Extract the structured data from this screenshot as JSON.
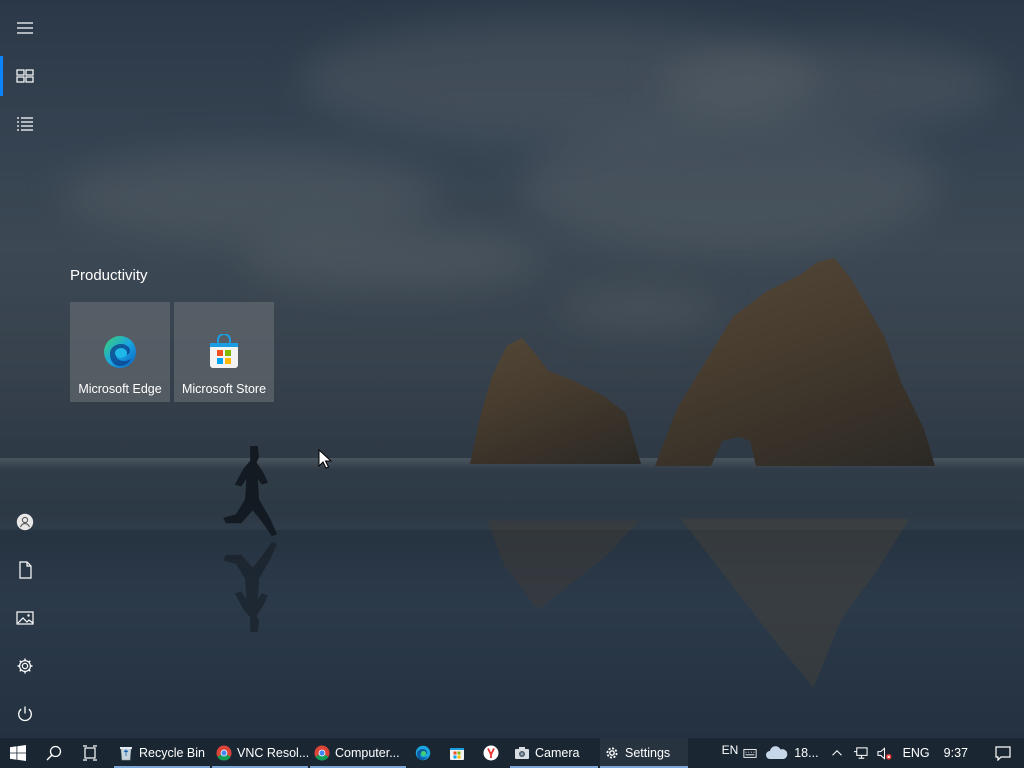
{
  "start_menu": {
    "rail": {
      "items": [
        {
          "name": "expand",
          "icon": "hamburger-icon"
        },
        {
          "name": "pinned-tiles",
          "icon": "tiles-icon",
          "active": true
        },
        {
          "name": "all-apps",
          "icon": "list-icon"
        },
        {
          "name": "user",
          "icon": "user-icon"
        },
        {
          "name": "documents",
          "icon": "document-icon"
        },
        {
          "name": "pictures",
          "icon": "picture-icon"
        },
        {
          "name": "settings",
          "icon": "gear-icon"
        },
        {
          "name": "power",
          "icon": "power-icon"
        }
      ]
    },
    "group": {
      "title": "Productivity",
      "tiles": [
        {
          "label": "Microsoft Edge",
          "icon": "edge-icon"
        },
        {
          "label": "Microsoft Store",
          "icon": "store-icon"
        }
      ]
    }
  },
  "taskbar": {
    "start_icon": "windows-logo-icon",
    "search_icon": "search-icon",
    "task_view_icon": "task-view-icon",
    "apps": [
      {
        "label": "Recycle Bin",
        "icon": "recycle-bin-icon",
        "running": true
      },
      {
        "label": "VNC Resol...",
        "icon": "chrome-icon",
        "running": true
      },
      {
        "label": "Computer...",
        "icon": "chrome-icon",
        "running": true
      },
      {
        "label": "",
        "icon": "edge-icon"
      },
      {
        "label": "",
        "icon": "store-icon"
      },
      {
        "label": "",
        "icon": "yandex-icon"
      },
      {
        "label": "Camera",
        "icon": "camera-icon",
        "running": true
      },
      {
        "label": "Settings",
        "icon": "gear-icon",
        "running": true,
        "active": true
      }
    ],
    "tray": {
      "language_short": "EN",
      "keyboard_icon": "keyboard-icon",
      "weather_icon": "cloud-icon",
      "weather_text": "18...",
      "chevron_icon": "chevron-up-icon",
      "network_icon": "network-icon",
      "volume_icon": "volume-muted-icon",
      "language": "ENG",
      "time": "9:37",
      "notifications_icon": "notification-icon"
    }
  },
  "colors": {
    "accent": "#0a84ff",
    "taskbar": "#1a2733",
    "tile": "#6e7378"
  }
}
